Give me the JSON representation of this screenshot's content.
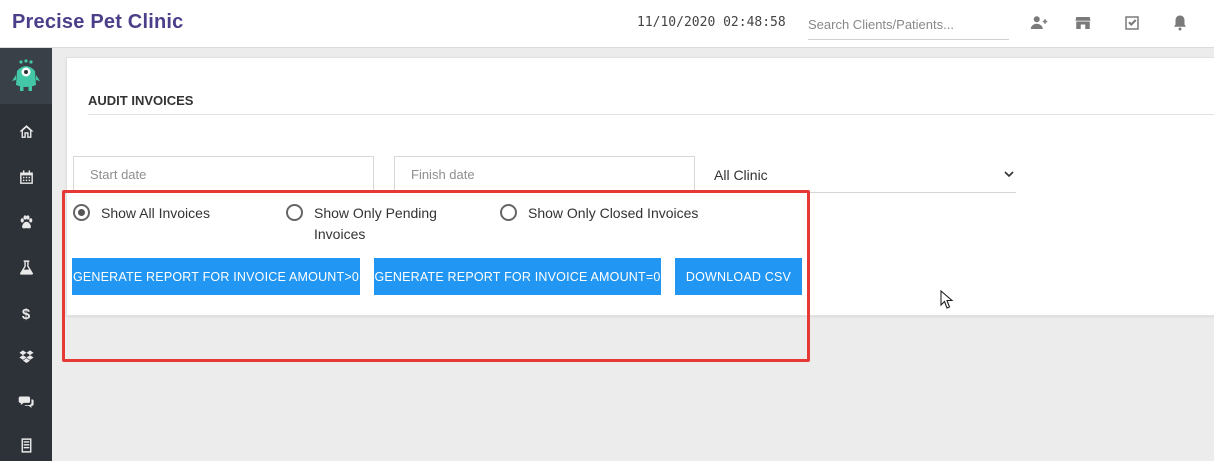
{
  "app": {
    "title": "Precise Pet Clinic"
  },
  "header": {
    "datetime": "11/10/2020 02:48:58",
    "search_placeholder": "Search Clients/Patients...",
    "icons": [
      "add-client-icon",
      "store-icon",
      "checkbox-icon",
      "bell-icon"
    ]
  },
  "sidebar": {
    "logo": "monster-logo-icon",
    "items": [
      {
        "name": "home",
        "icon": "home-icon"
      },
      {
        "name": "calendar",
        "icon": "calendar-icon"
      },
      {
        "name": "patients",
        "icon": "paw-icon"
      },
      {
        "name": "lab",
        "icon": "flask-icon"
      },
      {
        "name": "billing",
        "icon": "dollar-icon",
        "glyph": "$"
      },
      {
        "name": "inventory",
        "icon": "dropbox-icon"
      },
      {
        "name": "messages",
        "icon": "chat-icon"
      },
      {
        "name": "reports",
        "icon": "document-icon"
      }
    ]
  },
  "main": {
    "title": "AUDIT INVOICES",
    "start_date_placeholder": "Start date",
    "finish_date_placeholder": "Finish date",
    "clinic_select": {
      "value": "All Clinic"
    },
    "filters": [
      {
        "label": "Show All Invoices",
        "selected": true
      },
      {
        "label_line1": "Show Only Pending",
        "label_line2": "Invoices",
        "selected": false
      },
      {
        "label": "Show Only Closed Invoices",
        "selected": false
      }
    ],
    "buttons": {
      "report_gt0": "GENERATE REPORT FOR INVOICE AMOUNT>0",
      "report_eq0": "GENERATE REPORT FOR INVOICE AMOUNT=0",
      "download_csv": "DOWNLOAD CSV"
    }
  },
  "colors": {
    "brand": "#4b3f8a",
    "sidebar": "#2d3238",
    "button": "#2196f3",
    "highlight": "#e53935",
    "background": "#ececec"
  }
}
